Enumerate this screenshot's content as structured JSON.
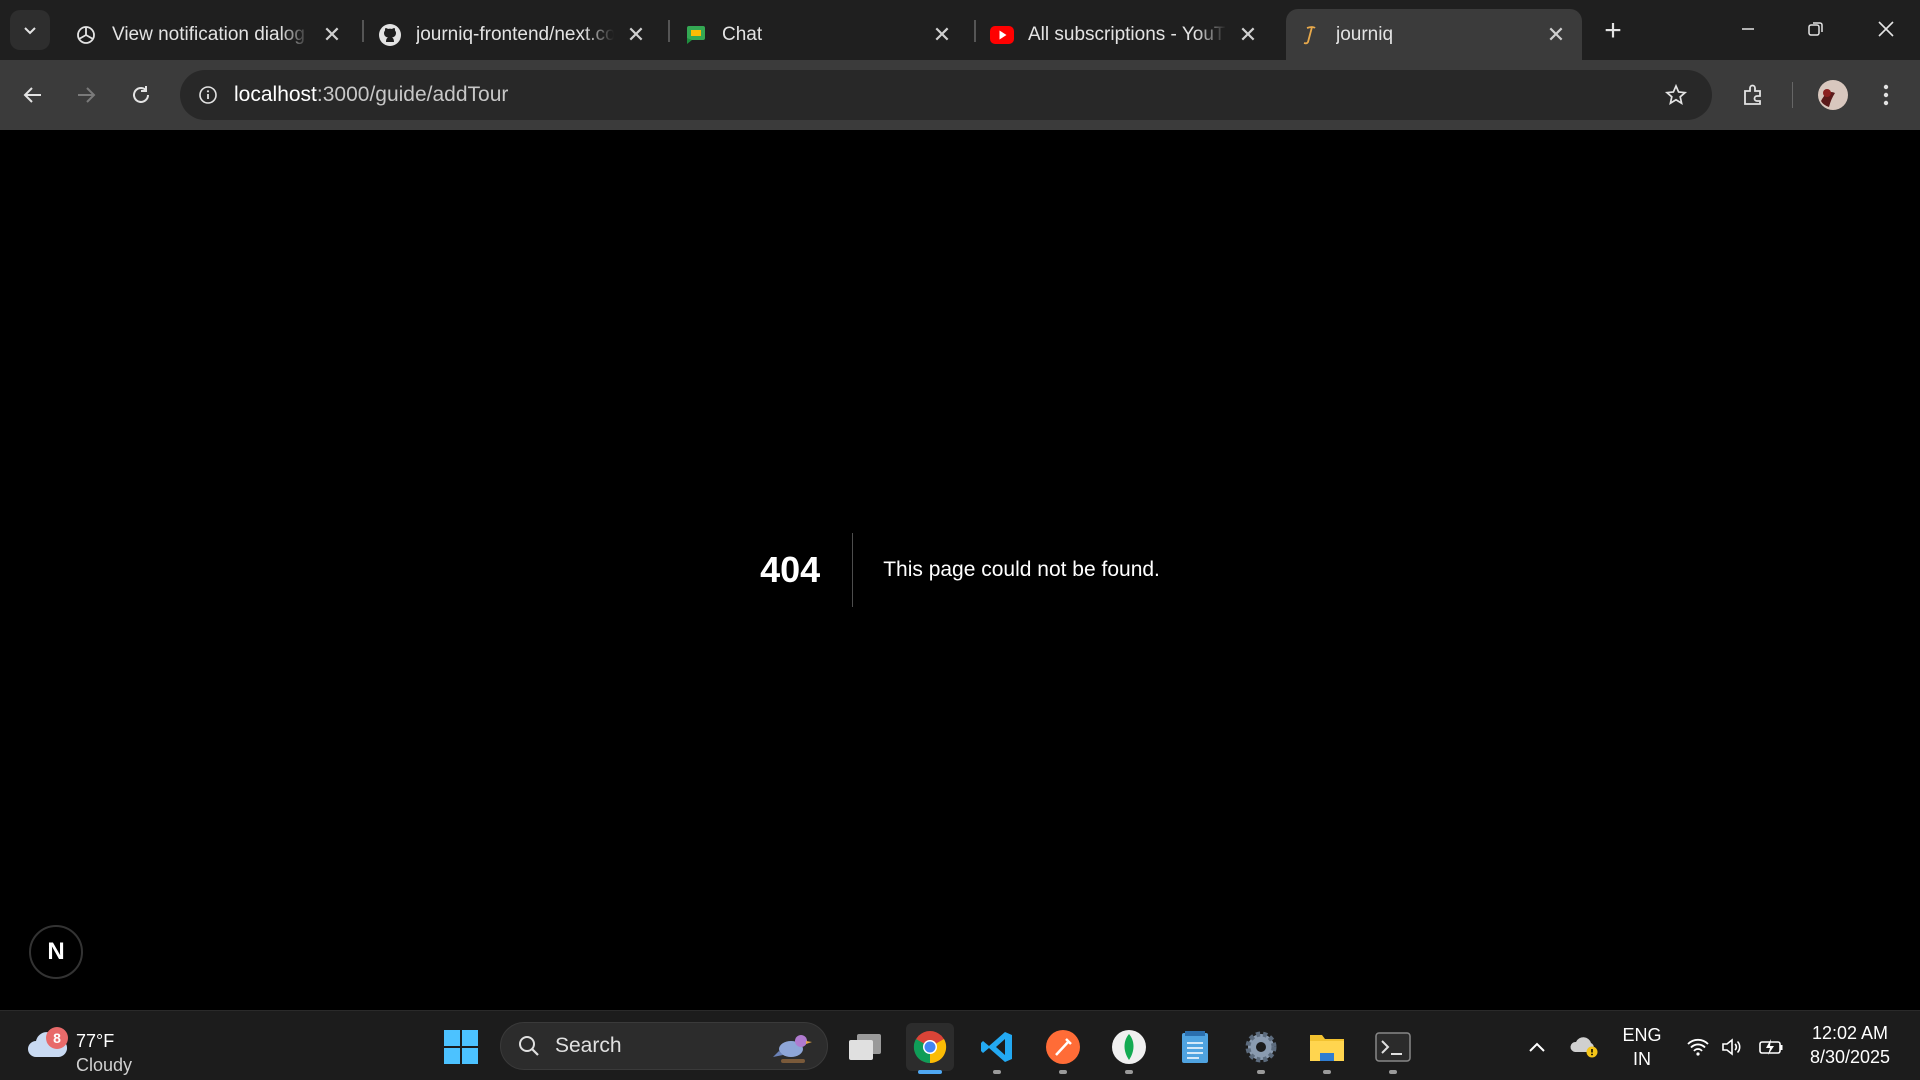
{
  "browser": {
    "tabs": [
      {
        "title": "View notification dialog b",
        "icon": "openai-icon"
      },
      {
        "title": "journiq-frontend/next.co",
        "icon": "github-icon"
      },
      {
        "title": "Chat",
        "icon": "google-chat-icon"
      },
      {
        "title": "All subscriptions - YouTul",
        "icon": "youtube-icon"
      },
      {
        "title": "journiq",
        "icon": "journiq-favicon",
        "active": true
      }
    ],
    "close_glyph": "✕",
    "new_tab_glyph": "+",
    "address": {
      "host": "localhost",
      "path": ":3000/guide/addTour"
    }
  },
  "page": {
    "error_code": "404",
    "error_message": "This page could not be found.",
    "next_badge": "N"
  },
  "taskbar": {
    "weather": {
      "badge": "8",
      "temperature": "77°F",
      "condition": "Cloudy"
    },
    "search_placeholder": "Search",
    "language": {
      "line1": "ENG",
      "line2": "IN"
    },
    "clock": {
      "time": "12:02 AM",
      "date": "8/30/2025"
    },
    "pinned": [
      "task-view-icon",
      "chrome-icon",
      "vscode-icon",
      "postman-icon",
      "mongodb-compass-icon",
      "notepad-icon",
      "settings-icon",
      "file-explorer-icon",
      "terminal-icon"
    ]
  },
  "colors": {
    "accent": "#4fa8f2",
    "tab_active": "#3b3b3b",
    "tabstrip": "#1f1f1f"
  }
}
